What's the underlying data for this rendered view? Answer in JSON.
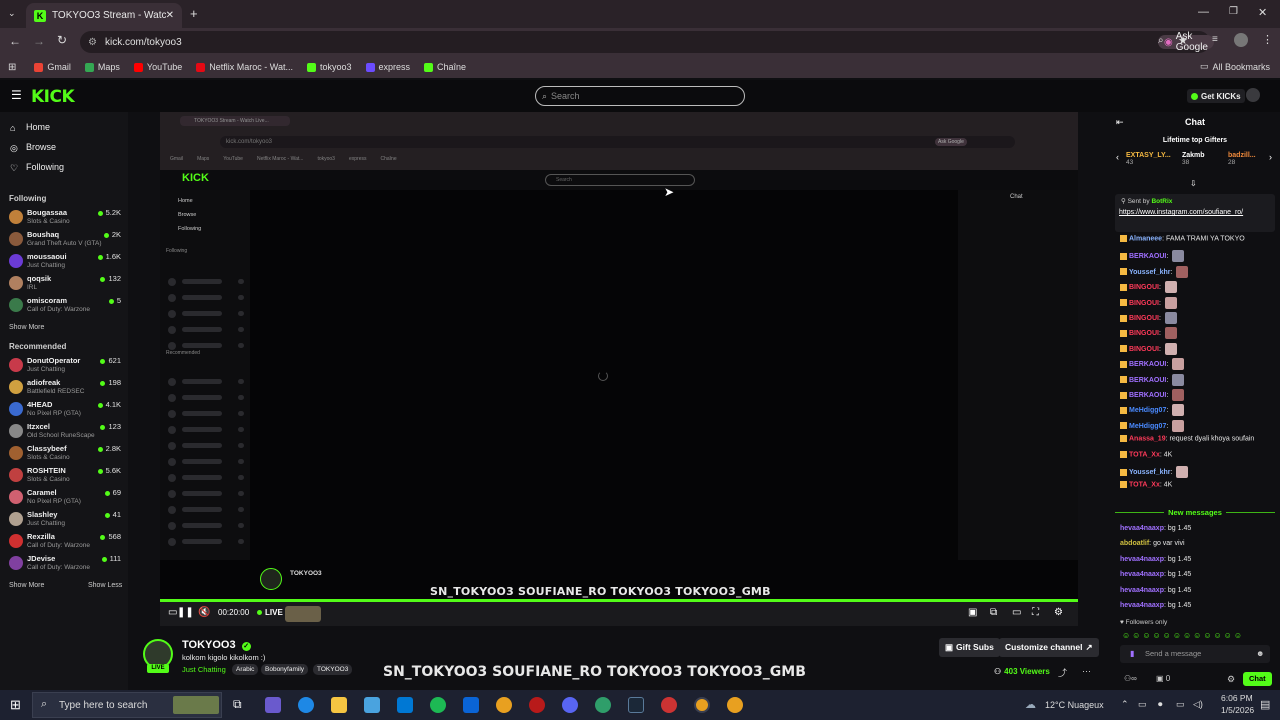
{
  "browser": {
    "tab_title": "TOKYOO3 Stream - Watch Live...",
    "url": "kick.com/tokyoo3",
    "ask_google": "Ask Google",
    "bookmarks": [
      {
        "label": "Gmail",
        "color": "#ea4335"
      },
      {
        "label": "Maps",
        "color": "#34a853"
      },
      {
        "label": "YouTube",
        "color": "#ff0000"
      },
      {
        "label": "Netflix Maroc - Wat...",
        "color": "#e50914"
      },
      {
        "label": "tokyoo3",
        "color": "#53fc18"
      },
      {
        "label": "express",
        "color": "#6b4cff"
      },
      {
        "label": "Chaîne",
        "color": "#53fc18"
      }
    ],
    "all_bookmarks": "All Bookmarks"
  },
  "kick": {
    "logo": "KICK",
    "search_placeholder": "Search",
    "get_kicks": "Get KICKs",
    "nav": {
      "home": "Home",
      "browse": "Browse",
      "following": "Following"
    },
    "following_header": "Following",
    "following": [
      {
        "name": "Bougassaa",
        "category": "Slots & Casino",
        "viewers": "5.2K",
        "color": "#c0803a"
      },
      {
        "name": "Boushaq",
        "category": "Grand Theft Auto V (GTA)",
        "viewers": "2K",
        "color": "#8a5a3c"
      },
      {
        "name": "moussaoui",
        "category": "Just Chatting",
        "viewers": "1.6K",
        "color": "#6b3bd6"
      },
      {
        "name": "qoqsik",
        "category": "IRL",
        "viewers": "132",
        "color": "#b08060"
      },
      {
        "name": "omiscoram",
        "category": "Call of Duty: Warzone",
        "viewers": "5",
        "color": "#3a7a4a"
      }
    ],
    "show_more": "Show More",
    "recommended_header": "Recommended",
    "recommended": [
      {
        "name": "DonutOperator",
        "category": "Just Chatting",
        "viewers": "621",
        "color": "#c83a4a"
      },
      {
        "name": "adiofreak",
        "category": "Battlefield REDSEC",
        "viewers": "198",
        "color": "#d0a040"
      },
      {
        "name": "4HEAD",
        "category": "No Pixel RP (GTA)",
        "viewers": "4.1K",
        "color": "#3a6ad0"
      },
      {
        "name": "Itzxcel",
        "category": "Old School RuneScape",
        "viewers": "123",
        "color": "#888"
      },
      {
        "name": "Classybeef",
        "category": "Slots & Casino",
        "viewers": "2.8K",
        "color": "#a06030"
      },
      {
        "name": "ROSHTEIN",
        "category": "Slots & Casino",
        "viewers": "5.6K",
        "color": "#c04040"
      },
      {
        "name": "Caramel",
        "category": "No Pixel RP (GTA)",
        "viewers": "69",
        "color": "#d06070"
      },
      {
        "name": "Slashley",
        "category": "Just Chatting",
        "viewers": "41",
        "color": "#b0a090"
      },
      {
        "name": "Rexzilla",
        "category": "Call of Duty: Warzone",
        "viewers": "568",
        "color": "#d03030"
      },
      {
        "name": "JDevise",
        "category": "Call of Duty: Warzone",
        "viewers": "111",
        "color": "#8040a0"
      }
    ],
    "show_less": "Show Less"
  },
  "player": {
    "inner_url": "kick.com/tokyoo3",
    "inner_search": "Search",
    "inner_streamer": "TOKYOO3",
    "ticker": "SN_TOKYOO3  SOUFIANE_RO  TOKYOO3  TOKYOO3_GMB",
    "time": "00:20:00",
    "live": "LIVE",
    "progress": 1.0
  },
  "channel": {
    "name": "TOKYOO3",
    "live_badge": "LIVE",
    "title": "kolkom kigolo kikolkom    :)",
    "category": "Just Chatting",
    "tags": [
      "Arabic",
      "Bobonyfamily",
      "TOKYOO3"
    ],
    "gift_subs": "Gift Subs",
    "customize": "Customize channel",
    "viewers": "403 Viewers",
    "ticker": "SN_TOKYOO3   SOUFIANE_RO   TOKYOO3   TOKYOO3_GMB"
  },
  "chat": {
    "title": "Chat",
    "gifters_header": "Lifetime top Gifters",
    "gifters": [
      {
        "name": "EXTASY_LY...",
        "count": "43"
      },
      {
        "name": "Zakmb",
        "count": "38"
      },
      {
        "name": "badzill...",
        "count": "28"
      }
    ],
    "pinned_by": "Sent by",
    "pinned_user": "BotRix",
    "pinned_text": "https://www.instagram.com/soufiane_ro/",
    "messages": [
      {
        "user": "Almaneee",
        "text": "FAMA TRAMI YA TOKYO",
        "color": "#8ab4ff"
      },
      {
        "user": "BERKAOUI",
        "text": "",
        "color": "#a070ff"
      },
      {
        "user": "Youssef_khr",
        "text": "",
        "color": "#8ab4ff"
      },
      {
        "user": "BINGOUI",
        "text": "",
        "color": "#ff3a5a"
      },
      {
        "user": "BINGOUI",
        "text": "",
        "color": "#ff3a5a"
      },
      {
        "user": "BINGOUI",
        "text": "",
        "color": "#ff3a5a"
      },
      {
        "user": "BINGOUI",
        "text": "",
        "color": "#ff3a5a"
      },
      {
        "user": "BINGOUI",
        "text": "",
        "color": "#ff3a5a"
      },
      {
        "user": "BERKAOUI",
        "text": "",
        "color": "#a070ff"
      },
      {
        "user": "BERKAOUI",
        "text": "",
        "color": "#a070ff"
      },
      {
        "user": "BERKAOUI",
        "text": "",
        "color": "#a070ff"
      },
      {
        "user": "MeHdigg07",
        "text": "",
        "color": "#4a8aff"
      },
      {
        "user": "MeHdigg07",
        "text": "",
        "color": "#4a8aff"
      },
      {
        "user": "Anassa_19",
        "text": "request dyali khoya soufain",
        "color": "#ff3a5a"
      },
      {
        "user": "TOTA_Xx",
        "text": "4K",
        "color": "#ff3a5a"
      },
      {
        "user": "Youssef_khr",
        "text": "",
        "color": "#8ab4ff"
      },
      {
        "user": "TOTA_Xx",
        "text": "4K",
        "color": "#ff3a5a"
      }
    ],
    "new_messages": "New messages",
    "new": [
      {
        "user": "hevaa4naaxp",
        "text": "bg 1.45",
        "color": "#a070ff"
      },
      {
        "user": "abdoatlif",
        "text": "go var vivi",
        "color": "#d0c040"
      },
      {
        "user": "hevaa4naaxp",
        "text": "bg 1.45",
        "color": "#a070ff"
      },
      {
        "user": "hevaa4naaxp",
        "text": "bg 1.45",
        "color": "#a070ff"
      },
      {
        "user": "hevaa4naaxp",
        "text": "bg 1.45",
        "color": "#a070ff"
      },
      {
        "user": "hevaa4naaxp",
        "text": "bg 1.45",
        "color": "#a070ff"
      }
    ],
    "followers_only": "Followers only",
    "send_placeholder": "Send a message",
    "chat_button": "Chat",
    "count": "0"
  },
  "taskbar": {
    "search": "Type here to search",
    "weather": "12°C  Nuageux",
    "time": "6:06 PM",
    "date": "1/5/2026"
  }
}
